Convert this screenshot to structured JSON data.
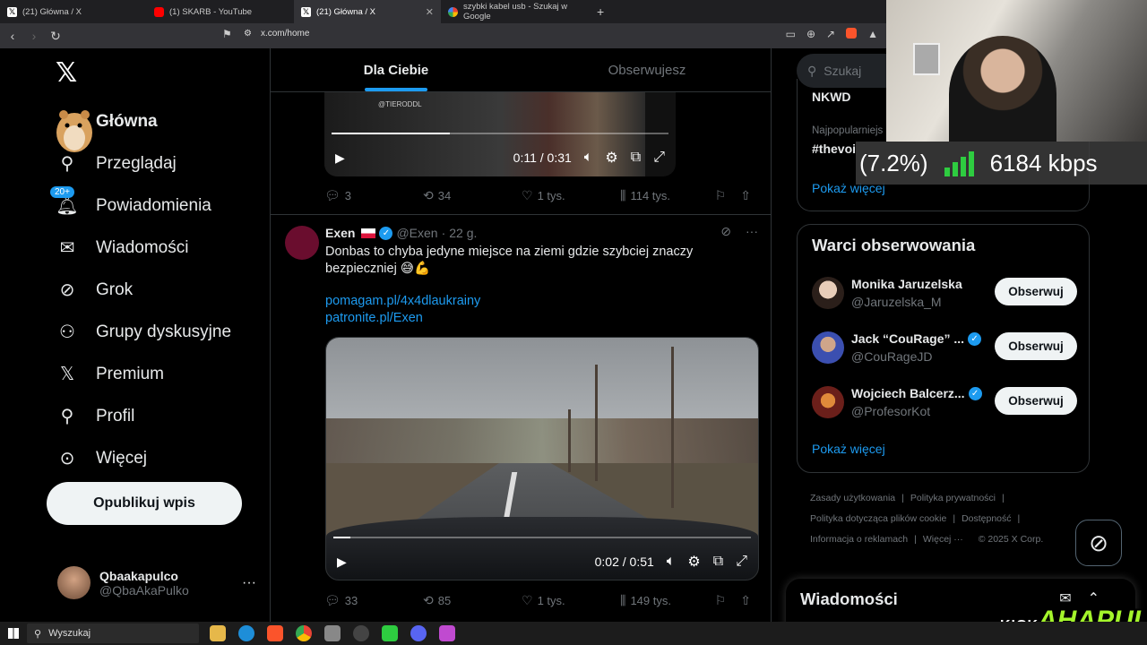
{
  "browser": {
    "tabs": [
      {
        "title": "(21) Główna / X",
        "favicon": "x-icon"
      },
      {
        "title": "(1) SKARB - YouTube",
        "favicon": "youtube-icon"
      },
      {
        "title": "(21) Główna / X",
        "favicon": "x-icon",
        "active": true
      },
      {
        "title": "szybki kabel usb - Szukaj w Google",
        "favicon": "google-icon"
      }
    ],
    "url": "x.com/home"
  },
  "sidebar": {
    "items": [
      {
        "label": "Główna",
        "icon": "home-icon"
      },
      {
        "label": "Przeglądaj",
        "icon": "search-icon"
      },
      {
        "label": "Powiadomienia",
        "icon": "bell-icon",
        "badge": "20+"
      },
      {
        "label": "Wiadomości",
        "icon": "mail-icon"
      },
      {
        "label": "Grok",
        "icon": "grok-icon"
      },
      {
        "label": "Grupy dyskusyjne",
        "icon": "people-icon"
      },
      {
        "label": "Premium",
        "icon": "x-icon"
      },
      {
        "label": "Profil",
        "icon": "person-icon"
      },
      {
        "label": "Więcej",
        "icon": "more-circle-icon"
      }
    ],
    "publish_label": "Opublikuj wpis",
    "account": {
      "name": "Qbaakapulco",
      "handle": "@QbaAkaPulko"
    }
  },
  "feed": {
    "tabs": [
      {
        "label": "Dla Ciebie",
        "active": true
      },
      {
        "label": "Obserwujesz"
      }
    ],
    "video1": {
      "watermark": "@TIERODDL",
      "time": "0:11 / 0:31",
      "progress": 0.35
    },
    "post1_actions": {
      "replies": "3",
      "reposts": "34",
      "likes": "1 tys.",
      "views": "114 tys."
    },
    "post2": {
      "name": "Exen",
      "handle": "@Exen",
      "age": "22 g.",
      "text": "Donbas to chyba jedyne miejsce na ziemi gdzie szybciej znaczy bezpieczniej 😅💪",
      "links": [
        "pomagam.pl/4x4dlaukrainy",
        "patronite.pl/Exen"
      ],
      "video_time": "0:02 / 0:51",
      "progress": 0.04,
      "actions": {
        "replies": "33",
        "reposts": "85",
        "likes": "1 tys.",
        "views": "149 tys."
      }
    }
  },
  "right": {
    "search_placeholder": "Szukaj",
    "trends": {
      "first": "NKWD",
      "meta": "Najpopularniejs",
      "second": "#thevoi",
      "show_more": "Pokaż więcej"
    },
    "who_to_follow": {
      "title": "Warci obserwowania",
      "people": [
        {
          "name": "Monika Jaruzelska",
          "handle": "@Jaruzelska_M",
          "verified": false,
          "button": "Obserwuj"
        },
        {
          "name": "Jack “CouRage” ...",
          "handle": "@CouRageJD",
          "verified": true,
          "button": "Obserwuj"
        },
        {
          "name": "Wojciech Balcerz...",
          "handle": "@ProfesorKot",
          "verified": true,
          "button": "Obserwuj"
        }
      ],
      "show_more": "Pokaż więcej"
    },
    "footer": [
      "Zasady użytkowania",
      "Polityka prywatności",
      "Polityka dotycząca plików cookie",
      "Dostępność",
      "Informacja o reklamach",
      "Więcej ···",
      "© 2025 X Corp."
    ],
    "messages_title": "Wiadomości"
  },
  "stream": {
    "loss": "(7.2%)",
    "bitrate": "6184 kbps",
    "platform": "KICK",
    "brand": "AHAPULCO"
  },
  "taskbar": {
    "search": "Wyszukaj"
  }
}
